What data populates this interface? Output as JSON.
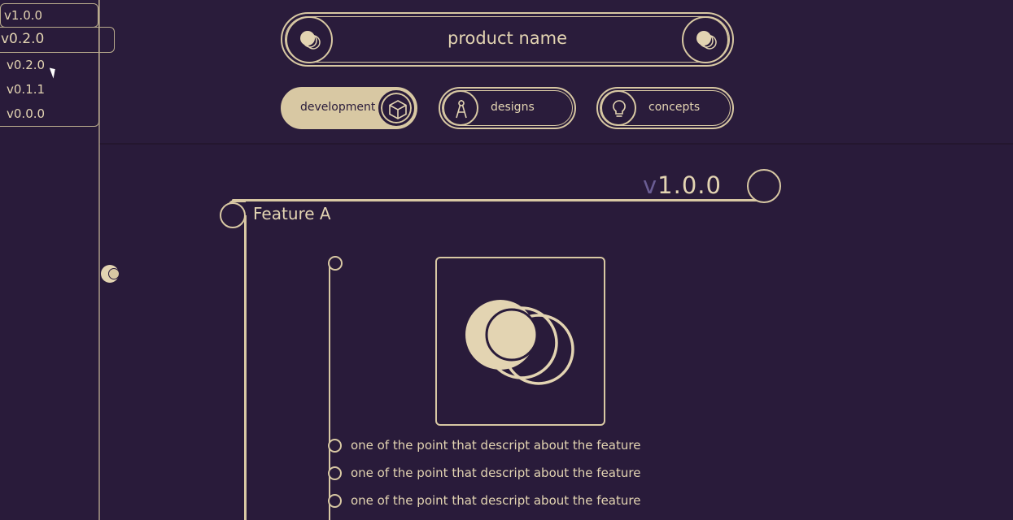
{
  "sidebar": {
    "versions": [
      {
        "label": "v1.0.0"
      },
      {
        "label": "v0.2.0"
      },
      {
        "label": "v0.2.0"
      },
      {
        "label": "v0.1.1"
      },
      {
        "label": "v0.0.0"
      }
    ]
  },
  "header": {
    "title": "product name",
    "left_icon": "toggle-circles-icon",
    "right_icon": "toggle-circles-icon"
  },
  "tabs": [
    {
      "label": "development",
      "icon": "cube-icon",
      "active": true
    },
    {
      "label": "designs",
      "icon": "compass-icon",
      "active": false
    },
    {
      "label": "concepts",
      "icon": "lightbulb-icon",
      "active": false
    }
  ],
  "release": {
    "prefix": "v",
    "number": "1.0.0"
  },
  "feature": {
    "title": "Feature A",
    "image_icon": "overlapping-circles-icon",
    "points": [
      "one of the point that descript about the feature",
      "one of the point that descript about the feature",
      "one of the point that descript about the feature"
    ]
  },
  "colors": {
    "background": "#291b3a",
    "accent": "#d8c8a3",
    "text": "#e3d4b2",
    "version_prefix": "#6a5d93"
  }
}
